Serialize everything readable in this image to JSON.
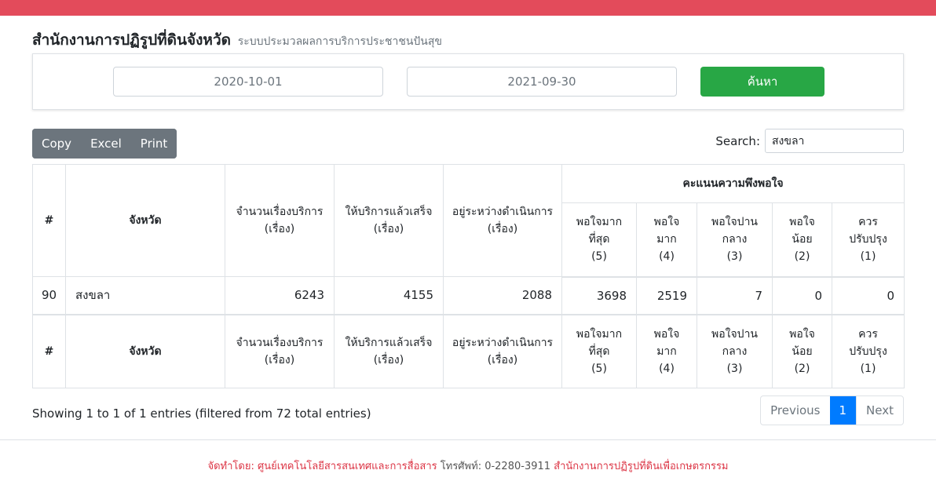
{
  "header": {
    "title": "สำนักงานการปฏิรูปที่ดินจังหวัด",
    "subtitle": "ระบบประมวลผลการบริการประชาชนปันสุข"
  },
  "filter": {
    "start_date": "2020-10-01",
    "end_date": "2021-09-30",
    "search_label": "ค้นหา"
  },
  "toolbar": {
    "copy_label": "Copy",
    "excel_label": "Excel",
    "print_label": "Print",
    "search_caption": "Search:",
    "search_value": "สงขลา"
  },
  "table": {
    "col_num": "#",
    "col_province": "จังหวัด",
    "col_total": [
      "จำนวนเรื่องบริการ",
      "(เรื่อง)"
    ],
    "col_done": [
      "ให้บริการแล้วเสร็จ",
      "(เรื่อง)"
    ],
    "col_pending": [
      "อยู่ระหว่างดำเนินการ",
      "(เรื่อง)"
    ],
    "group_satisfaction": "คะแนนความพึงพอใจ",
    "col_s5": [
      "พอใจมาก",
      "ที่สุด",
      "(5)"
    ],
    "col_s4": [
      "พอใจ",
      "มาก",
      "(4)"
    ],
    "col_s3": [
      "พอใจปาน",
      "กลาง",
      "(3)"
    ],
    "col_s2": [
      "พอใจ",
      "น้อย",
      "(2)"
    ],
    "col_s1": [
      "ควร",
      "ปรับปรุง",
      "(1)"
    ],
    "row": {
      "num": "90",
      "province": "สงขลา",
      "total": "6243",
      "done": "4155",
      "pending": "2088",
      "s5": "3698",
      "s4": "2519",
      "s3": "7",
      "s2": "0",
      "s1": "0"
    }
  },
  "info_text": "Showing 1 to 1 of 1 entries (filtered from 72 total entries)",
  "pagination": {
    "previous": "Previous",
    "page": "1",
    "next": "Next"
  },
  "footer": {
    "prefix": "จัดทำโดย: ศูนย์เทคโนโลยีสารสนเทศและการสื่อสาร",
    "phone": "โทรศัพท์: 0-2280-3911",
    "org": "สำนักงานการปฏิรูปที่ดินเพื่อเกษตรกรรม"
  },
  "colors": {
    "topbar": "#e34b5b",
    "search_button": "#28a745",
    "toolbar_button": "#6c757d",
    "active_page": "#007bff",
    "footer_red": "#dc3545"
  }
}
